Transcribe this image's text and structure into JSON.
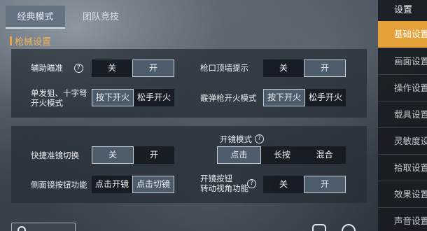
{
  "tabs": [
    "经典模式",
    "团队竞技"
  ],
  "section_title": "枪械设置",
  "panel1": {
    "aim_assist": {
      "label": "辅助瞄准",
      "options": [
        "关",
        "开"
      ],
      "selected": 1
    },
    "muzzle_hint": {
      "label": "枪口顶墙提示",
      "options": [
        "关",
        "开"
      ],
      "selected": 1
    },
    "single_fire": {
      "label_line1": "单发狙、十字弩",
      "label_line2": "开火模式",
      "options": [
        "按下开火",
        "松手开火"
      ],
      "selected": 0
    },
    "shotgun_fire": {
      "label": "霰弹枪开火模式",
      "options": [
        "按下开火",
        "松手开火"
      ],
      "selected": 0
    }
  },
  "panel2": {
    "quick_scope": {
      "label": "快捷准镜切换",
      "options": [
        "关",
        "开"
      ],
      "selected": 0
    },
    "scope_mode": {
      "label": "开镜模式",
      "options": [
        "点击",
        "长按",
        "混合"
      ],
      "selected": 0
    },
    "side_scope": {
      "label": "侧面镜按钮功能",
      "options": [
        "点击开镜",
        "点击切镜"
      ],
      "selected": 1
    },
    "scope_view": {
      "label_line1": "开镜按钮",
      "label_line2": "转动视角功能",
      "options": [
        "关",
        "开"
      ],
      "selected": 1
    }
  },
  "help_glyph": "?",
  "sidebar": {
    "title": "设置",
    "items": [
      "基础设置",
      "画面设置",
      "操作设置",
      "载具设置",
      "灵敏度设置",
      "拾取设置",
      "效果设置",
      "声音设置"
    ],
    "active": 0
  },
  "colors": {
    "accent": "#e4a139",
    "section": "#f0b35a"
  },
  "icons": [
    "help-icon",
    "reset-icon",
    "settings-icon"
  ]
}
